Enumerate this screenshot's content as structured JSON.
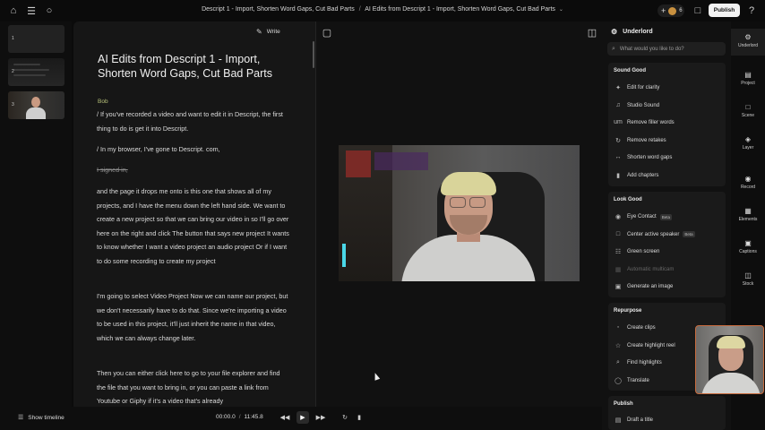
{
  "topbar": {
    "breadcrumb_project": "Descript 1 - Import, Shorten Word Gaps, Cut Bad Parts",
    "breadcrumb_separator": "/",
    "breadcrumb_composition": "AI Edits from Descript 1 - Import, Shorten Word Gaps, Cut Bad Parts",
    "collaborator_count": "6",
    "publish_label": "Publish"
  },
  "scenes": [
    {
      "number": "1"
    },
    {
      "number": "2"
    },
    {
      "number": "3"
    }
  ],
  "script": {
    "write_label": "Write",
    "title": "AI Edits from Descript 1 - Import, Shorten Word Gaps, Cut Bad Parts",
    "speaker": "Bob",
    "paragraphs": [
      "/  If you've recorded a video and want to edit it in Descript, the first thing to do is get it into Descript.",
      "/  In my browser, I've gone to Descript. com,",
      "I signed in,",
      "and the page it drops me onto is this one that shows all of my projects, and I have the menu down the left hand side. We want to create a new project so that we can bring our video in so I'll go over here on the right and click The button that says new project It wants to know whether I want a video project an audio project Or if I want to do some recording to create my project",
      "I'm going to select Video Project Now we can name our project, but we don't necessarily have to do that. Since we're importing a video to be used in this project, it'll just inherit the name in that video, which we can always change later.",
      "Then you can either click here to go to your file explorer and find the file that you want to bring in, or you can paste a link from Youtube or Giphy if it's a video that's already"
    ]
  },
  "props": {
    "title": "Underlord",
    "search_placeholder": "What would you like to do?",
    "sections": [
      {
        "title": "Sound Good",
        "items": [
          {
            "label": "Edit for clarity",
            "icon": "wand-icon"
          },
          {
            "label": "Studio Sound",
            "icon": "studio-sound-icon"
          },
          {
            "label": "Remove filler words",
            "icon": "filler-words-icon"
          },
          {
            "label": "Remove retakes",
            "icon": "retakes-icon"
          },
          {
            "label": "Shorten word gaps",
            "icon": "word-gaps-icon"
          },
          {
            "label": "Add chapters",
            "icon": "bookmark-icon"
          }
        ]
      },
      {
        "title": "Look Good",
        "items": [
          {
            "label": "Eye Contact",
            "icon": "eye-icon",
            "badge": "Beta"
          },
          {
            "label": "Center active speaker",
            "icon": "center-speaker-icon",
            "badge": "Beta"
          },
          {
            "label": "Green screen",
            "icon": "green-screen-icon"
          },
          {
            "label": "Automatic multicam",
            "icon": "multicam-icon",
            "disabled": true
          },
          {
            "label": "Generate an image",
            "icon": "image-icon"
          }
        ]
      },
      {
        "title": "Repurpose",
        "items": [
          {
            "label": "Create clips",
            "icon": "clips-icon"
          },
          {
            "label": "Create highlight reel",
            "icon": "star-icon"
          },
          {
            "label": "Find highlights",
            "icon": "search-icon"
          },
          {
            "label": "Translate",
            "icon": "translate-icon"
          }
        ]
      },
      {
        "title": "Publish",
        "items": [
          {
            "label": "Draft a title",
            "icon": "title-icon"
          }
        ]
      }
    ]
  },
  "rail": [
    {
      "label": "Underlord",
      "icon": "underlord-icon"
    },
    {
      "label": "Project",
      "icon": "project-icon"
    },
    {
      "label": "Scene",
      "icon": "scene-icon"
    },
    {
      "label": "Layer",
      "icon": "layer-icon"
    },
    {
      "label": "Record",
      "icon": "record-icon"
    },
    {
      "label": "Elements",
      "icon": "elements-icon"
    },
    {
      "label": "Captions",
      "icon": "captions-icon"
    },
    {
      "label": "Stock",
      "icon": "stock-icon"
    }
  ],
  "transport": {
    "show_timeline_label": "Show timeline",
    "current_time": "00:00.0",
    "time_separator": "/",
    "total_time": "11:45.8"
  }
}
